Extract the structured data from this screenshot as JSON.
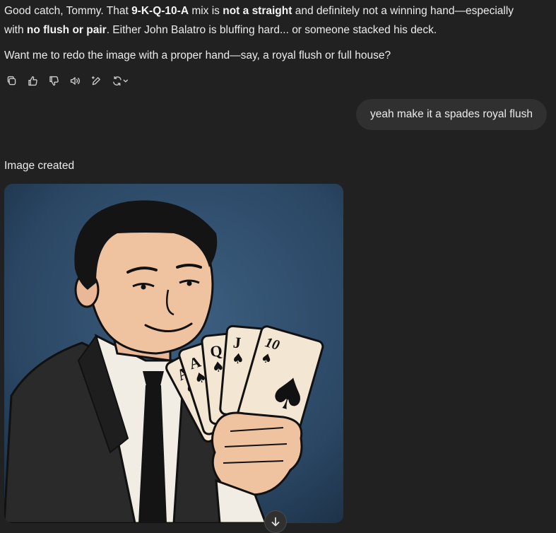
{
  "assistant": {
    "line1": [
      {
        "text": "Good catch, Tommy. That ",
        "bold": false
      },
      {
        "text": "9-K-Q-10-A",
        "bold": true
      },
      {
        "text": " mix is ",
        "bold": false
      },
      {
        "text": "not a straight",
        "bold": true
      },
      {
        "text": " and definitely not a winning hand—especially",
        "bold": false
      }
    ],
    "line2": [
      {
        "text": "with ",
        "bold": false
      },
      {
        "text": "no flush or pair",
        "bold": true
      },
      {
        "text": ". Either John Balatro is bluffing hard... or someone stacked his deck.",
        "bold": false
      }
    ],
    "line3": [
      {
        "text": "Want me to redo the image with a proper hand—say, a royal flush or full house?",
        "bold": false
      }
    ]
  },
  "actions": [
    {
      "icon": "copy-icon"
    },
    {
      "icon": "thumbs-up-icon"
    },
    {
      "icon": "thumbs-down-icon"
    },
    {
      "icon": "read-aloud-icon"
    },
    {
      "icon": "edit-canvas-icon"
    },
    {
      "icon": "regenerate-icon"
    }
  ],
  "user_message": "yeah make it a spades royal flush",
  "image_section": {
    "label": "Image created",
    "cards": [
      "A",
      "A",
      "Q",
      "J",
      "10"
    ]
  },
  "colors": {
    "background": "#212121",
    "user_bubble": "#303030",
    "image_bg": "#2f4d6b",
    "card": "#f3e6d2"
  },
  "scroll_icon": "arrow-down-icon"
}
